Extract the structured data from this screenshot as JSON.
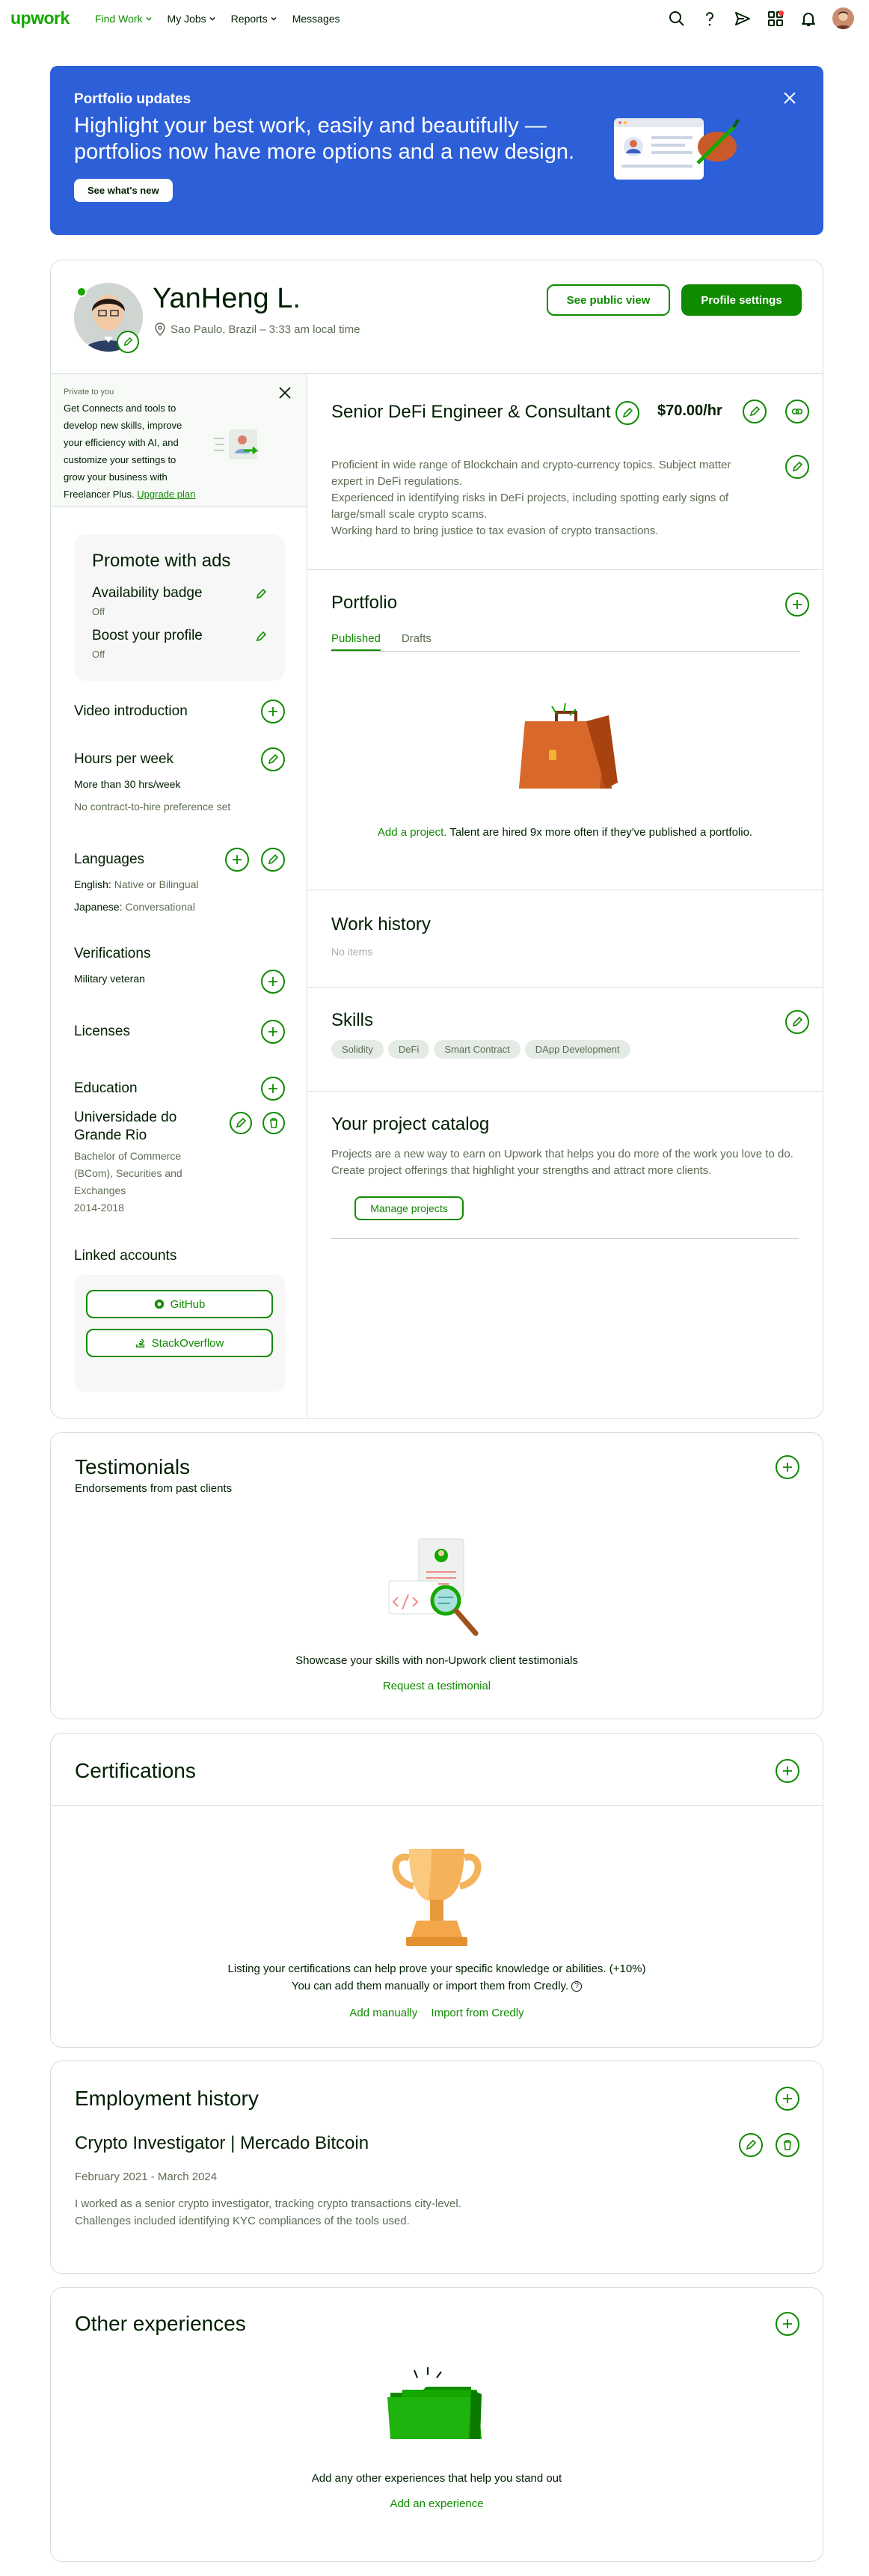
{
  "header": {
    "logo": "upwork",
    "nav": [
      "Find Work",
      "My Jobs",
      "Reports",
      "Messages"
    ],
    "icons": [
      "search-icon",
      "help-icon",
      "send-icon",
      "apps-icon",
      "bell-icon"
    ]
  },
  "banner": {
    "eyebrow": "Portfolio updates",
    "headline": "Highlight your best work, easily and beautifully — portfolios now have more options and a new design.",
    "button": "See what's new"
  },
  "profile": {
    "name": "YanHeng L.",
    "location": "Sao Paulo, Brazil – 3:33 am local time",
    "public_view": "See public view",
    "settings": "Profile settings"
  },
  "private_note": {
    "tag": "Private to you",
    "text": "Get Connects and tools to develop new skills, improve your efficiency with AI, and customize your settings to grow your business with Freelancer Plus.",
    "link": "Upgrade plan"
  },
  "promote": {
    "title": "Promote with ads",
    "items": [
      {
        "label": "Availability badge",
        "status": "Off"
      },
      {
        "label": "Boost your profile",
        "status": "Off"
      }
    ]
  },
  "left": {
    "video_title": "Video introduction",
    "hours_title": "Hours per week",
    "hours_value": "More than 30 hrs/week",
    "hours_note": "No contract-to-hire preference set",
    "languages_title": "Languages",
    "languages": [
      {
        "name": "English:",
        "level": "Native or Bilingual"
      },
      {
        "name": "Japanese:",
        "level": "Conversational"
      }
    ],
    "verifications_title": "Verifications",
    "verification": "Military veteran",
    "licenses_title": "Licenses",
    "education_title": "Education",
    "school": "Universidade do Grande Rio",
    "degree": "Bachelor of Commerce (BCom), Securities and Exchanges",
    "years": "2014-2018",
    "linked_title": "Linked accounts",
    "linked": [
      "GitHub",
      "StackOverflow"
    ]
  },
  "right": {
    "headline": "Senior DeFi Engineer & Consultant",
    "rate": "$70.00/hr",
    "overview": [
      "Proficient in wide range of Blockchain and crypto-currency topics. Subject matter expert in DeFi regulations.",
      "Experienced in identifying risks in DeFi projects, including spotting early signs of large/small scale crypto scams.",
      "Working hard to bring justice to tax evasion of crypto transactions."
    ],
    "portfolio_title": "Portfolio",
    "portfolio_tabs": [
      "Published",
      "Drafts"
    ],
    "portfolio_link": "Add a project.",
    "portfolio_text": " Talent are hired 9x more often if they've published a portfolio.",
    "work_title": "Work history",
    "work_empty": "No items",
    "skills_title": "Skills",
    "skills": [
      "Solidity",
      "DeFi",
      "Smart Contract",
      "DApp Development"
    ],
    "catalog_title": "Your project catalog",
    "catalog_text": "Projects are a new way to earn on Upwork that helps you do more of the work you love to do. Create project offerings that highlight your strengths and attract more clients.",
    "catalog_button": "Manage projects"
  },
  "testimonials": {
    "title": "Testimonials",
    "subtitle": "Endorsements from past clients",
    "text": "Showcase your skills with non-Upwork client testimonials",
    "link": "Request a testimonial"
  },
  "certifications": {
    "title": "Certifications",
    "text1": "Listing your certifications can help prove your specific knowledge or abilities. (+10%)",
    "text2": "You can add them manually or import them from Credly.",
    "link1": "Add manually",
    "link2": "Import from Credly"
  },
  "employment": {
    "title": "Employment history",
    "job": "Crypto Investigator | Mercado Bitcoin",
    "dates": "February 2021 - March 2024",
    "desc1": "I worked as a senior crypto investigator, tracking crypto transactions city-level.",
    "desc2": "Challenges included identifying KYC compliances of the tools used."
  },
  "other": {
    "title": "Other experiences",
    "text": "Add any other experiences that help you stand out",
    "link": "Add an experience"
  },
  "colors": {
    "brand": "#14a800",
    "accent": "#108a00",
    "banner": "#2d5fd9"
  }
}
